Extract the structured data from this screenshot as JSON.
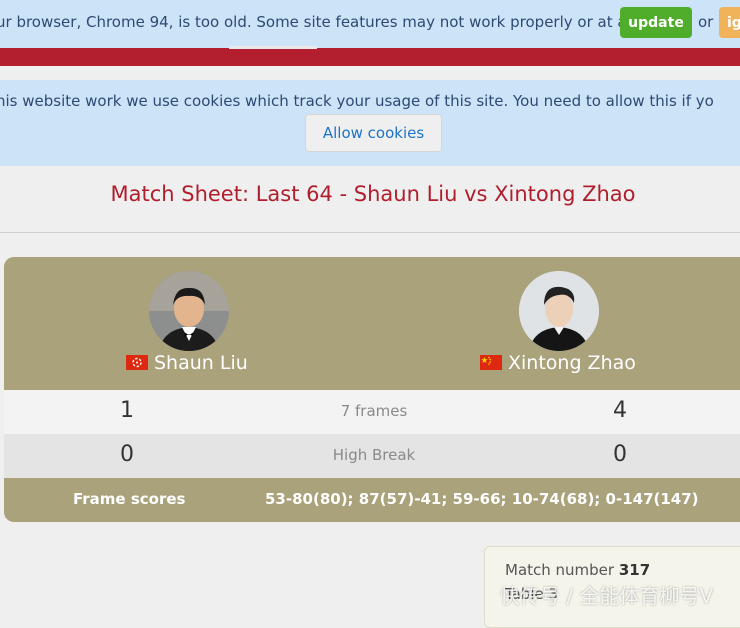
{
  "browser_warning": {
    "message": "ur browser, Chrome 94, is too old. Some site features may not work properly or at all.",
    "update_label": "update",
    "or_text": "or",
    "ignore_label": "ig"
  },
  "cookie_banner": {
    "message": "his website work we use cookies which track your usage of this site. You need to allow this if yo",
    "button_label": "Allow cookies"
  },
  "page_title": "Match Sheet: Last 64 - Shaun Liu vs Xintong Zhao",
  "match": {
    "player1": {
      "name": "Shaun Liu",
      "flag": "hong-kong-flag-icon",
      "frames": "1",
      "high_break": "0"
    },
    "player2": {
      "name": "Xintong Zhao",
      "flag": "china-flag-icon",
      "frames": "4",
      "high_break": "0"
    },
    "frames_label": "7 frames",
    "high_break_label": "High Break",
    "frame_scores_label": "Frame scores",
    "frame_scores": "53-80(80); 87(57)-41; 59-66; 10-74(68); 0-147(147)"
  },
  "info": {
    "match_number_label": "Match number",
    "match_number": "317",
    "table_label": "Table 3"
  },
  "watermark": "快传号 / 全能体育柳号V",
  "colors": {
    "accent_red": "#b01e2d",
    "card_olive": "#a9a27b",
    "update_green": "#4fad2b",
    "banner_blue": "#cde3f7"
  }
}
